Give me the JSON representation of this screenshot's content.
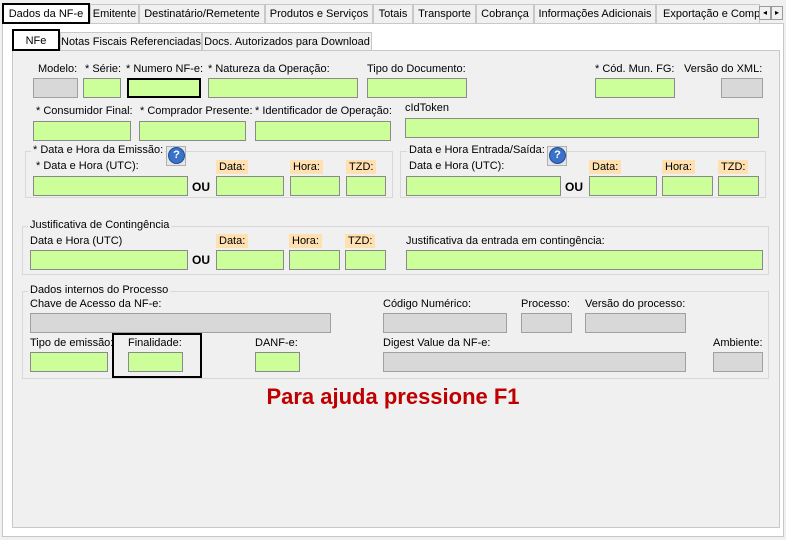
{
  "tabs": [
    "Dados da NF-e",
    "Emitente",
    "Destinatário/Remetente",
    "Produtos e Serviços",
    "Totais",
    "Transporte",
    "Cobrança",
    "Informações Adicionais",
    "Exportação e Compra"
  ],
  "subtabs": [
    "NFe",
    "Notas Fiscais Referenciadas",
    "Docs. Autorizados para Download"
  ],
  "row1": {
    "modelo": "Modelo:",
    "serie": "* Série:",
    "numero": "* Numero NF-e:",
    "natureza": "* Natureza da Operação:",
    "tipo_doc": "Tipo do Documento:",
    "cod_mun": "* Cód. Mun. FG:",
    "versao_xml": "Versão do XML:"
  },
  "row2": {
    "consumidor": "* Consumidor Final:",
    "comprador": "* Comprador Presente:",
    "identificador": "* Identificador de Operação:",
    "cid_token": "cIdToken"
  },
  "emissao": {
    "title": "* Data e Hora da Emissão:",
    "utc": "* Data e Hora (UTC):",
    "ou": "OU",
    "data": "Data:",
    "hora": "Hora:",
    "tzd": "TZD:"
  },
  "entrada": {
    "title": "Data e Hora Entrada/Saída:",
    "utc": "Data e Hora (UTC):",
    "ou": "OU",
    "data": "Data:",
    "hora": "Hora:",
    "tzd": "TZD:"
  },
  "contingencia": {
    "title": "Justificativa de Contingência",
    "utc": "Data e Hora (UTC)",
    "ou": "OU",
    "data": "Data:",
    "hora": "Hora:",
    "tzd": "TZD:",
    "justificativa": "Justificativa da entrada em contingência:"
  },
  "processo": {
    "title": "Dados internos do Processo",
    "chave": "Chave de Acesso da NF-e:",
    "codigo": "Código Numérico:",
    "processo": "Processo:",
    "versao": "Versão do processo:",
    "tipo_emissao": "Tipo de emissão:",
    "finalidade": "Finalidade:",
    "danfe": "DANF-e:",
    "digest": "Digest Value da NF-e:",
    "ambiente": "Ambiente:"
  },
  "help_text": "Para ajuda pressione F1",
  "icons": {
    "scroll_left": "◂",
    "scroll_right": "▸",
    "help": "?"
  }
}
